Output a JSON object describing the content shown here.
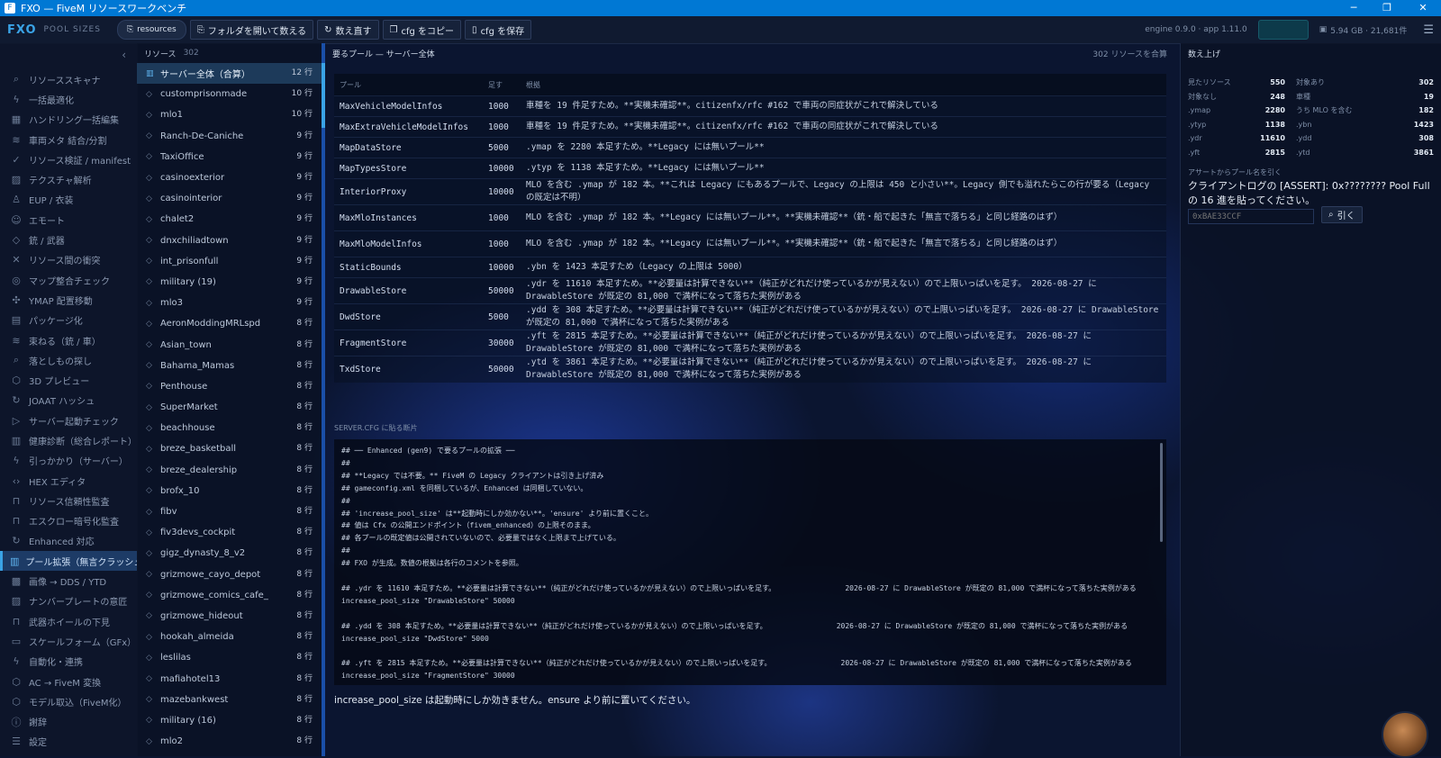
{
  "window": {
    "title": "FXO — FiveM リソースワークベンチ",
    "controls": {
      "minimize": "─",
      "restore": "❐",
      "close": "✕"
    }
  },
  "toolbar": {
    "logo": "FXO",
    "section": "POOL SIZES",
    "folder_pill": "resources",
    "buttons": {
      "open_count": "フォルダを開いて数える",
      "recount": "数え直す",
      "copy_cfg": "cfg をコピー",
      "save_cfg": "cfg を保存"
    },
    "version": "engine 0.9.0 · app 1.11.0",
    "system_info": "5.94 GB · 21,681件"
  },
  "sidebar": {
    "collapse": "‹",
    "items": [
      {
        "label": "リソーススキャナ",
        "icon": "search-icon",
        "glyph": "⌕"
      },
      {
        "label": "一括最適化",
        "icon": "bolt-icon",
        "glyph": "ϟ"
      },
      {
        "label": "ハンドリング一括編集",
        "icon": "grid-icon",
        "glyph": "▦"
      },
      {
        "label": "車両メタ 結合/分割",
        "icon": "layers-icon",
        "glyph": "≋"
      },
      {
        "label": "リソース検証 / manifest",
        "icon": "check-circle-icon",
        "glyph": "✓"
      },
      {
        "label": "テクスチャ解析",
        "icon": "image-icon",
        "glyph": "▨"
      },
      {
        "label": "EUP / 衣装",
        "icon": "person-icon",
        "glyph": "♙"
      },
      {
        "label": "エモート",
        "icon": "smile-icon",
        "glyph": "☺"
      },
      {
        "label": "銃 / 武器",
        "icon": "diamond-icon",
        "glyph": "◇"
      },
      {
        "label": "リソース間の衝突",
        "icon": "cross-icon",
        "glyph": "✕"
      },
      {
        "label": "マップ整合チェック",
        "icon": "map-pin-icon",
        "glyph": "◎"
      },
      {
        "label": "YMAP 配置移動",
        "icon": "move-icon",
        "glyph": "✣"
      },
      {
        "label": "パッケージ化",
        "icon": "package-icon",
        "glyph": "▤"
      },
      {
        "label": "束ねる（銃 / 車）",
        "icon": "stack-icon",
        "glyph": "≋"
      },
      {
        "label": "落としもの探し",
        "icon": "search-icon",
        "glyph": "⌕"
      },
      {
        "label": "3D プレビュー",
        "icon": "cube-icon",
        "glyph": "⬡"
      },
      {
        "label": "JOAAT ハッシュ",
        "icon": "refresh-icon",
        "glyph": "↻"
      },
      {
        "label": "サーバー起動チェック",
        "icon": "play-icon",
        "glyph": "▷"
      },
      {
        "label": "健康診断（総合レポート）",
        "icon": "chart-icon",
        "glyph": "▥"
      },
      {
        "label": "引っかかり（サーバー）",
        "icon": "bolt-icon",
        "glyph": "ϟ"
      },
      {
        "label": "HEX エディタ",
        "icon": "code-icon",
        "glyph": "‹›"
      },
      {
        "label": "リソース信頼性監査",
        "icon": "lock-icon",
        "glyph": "⊓"
      },
      {
        "label": "エスクロー暗号化監査",
        "icon": "lock-icon",
        "glyph": "⊓"
      },
      {
        "label": "Enhanced 対応",
        "icon": "sync-icon",
        "glyph": "↻"
      },
      {
        "label": "プール拡張（無言クラッシュ）",
        "icon": "bar-chart-icon",
        "glyph": "▥",
        "active": true
      },
      {
        "label": "画像 → DDS / YTD",
        "icon": "checker-icon",
        "glyph": "▩"
      },
      {
        "label": "ナンバープレートの意匠",
        "icon": "image-icon",
        "glyph": "▨"
      },
      {
        "label": "武器ホイールの下見",
        "icon": "lock-icon",
        "glyph": "⊓"
      },
      {
        "label": "スケールフォーム（GFx）",
        "icon": "monitor-icon",
        "glyph": "▭"
      },
      {
        "label": "自動化・連携",
        "icon": "bolt-icon",
        "glyph": "ϟ"
      },
      {
        "label": "AC → FiveM 変換",
        "icon": "cube-icon",
        "glyph": "⬡"
      },
      {
        "label": "モデル取込（FiveM化）",
        "icon": "cube-icon",
        "glyph": "⬡"
      },
      {
        "label": "謝辞",
        "icon": "info-icon",
        "glyph": "ⓘ"
      },
      {
        "label": "設定",
        "icon": "sliders-icon",
        "glyph": "☰"
      }
    ]
  },
  "resources": {
    "title": "リソース",
    "count": "302",
    "items": [
      {
        "name": "サーバー全体（合算）",
        "lines": "12 行",
        "active": true
      },
      {
        "name": "customprisonmade",
        "lines": "10 行"
      },
      {
        "name": "mlo1",
        "lines": "10 行"
      },
      {
        "name": "Ranch-De-Caniche",
        "lines": "9 行"
      },
      {
        "name": "TaxiOffice",
        "lines": "9 行"
      },
      {
        "name": "casinoexterior",
        "lines": "9 行"
      },
      {
        "name": "casinointerior",
        "lines": "9 行"
      },
      {
        "name": "chalet2",
        "lines": "9 行"
      },
      {
        "name": "dnxchiliadtown",
        "lines": "9 行"
      },
      {
        "name": "int_prisonfull",
        "lines": "9 行"
      },
      {
        "name": "military (19)",
        "lines": "9 行"
      },
      {
        "name": "mlo3",
        "lines": "9 行"
      },
      {
        "name": "AeronModdingMRLspd",
        "lines": "8 行"
      },
      {
        "name": "Asian_town",
        "lines": "8 行"
      },
      {
        "name": "Bahama_Mamas",
        "lines": "8 行"
      },
      {
        "name": "Penthouse",
        "lines": "8 行"
      },
      {
        "name": "SuperMarket",
        "lines": "8 行"
      },
      {
        "name": "beachhouse",
        "lines": "8 行"
      },
      {
        "name": "breze_basketball",
        "lines": "8 行"
      },
      {
        "name": "breze_dealership",
        "lines": "8 行"
      },
      {
        "name": "brofx_10",
        "lines": "8 行"
      },
      {
        "name": "fibv",
        "lines": "8 行"
      },
      {
        "name": "fiv3devs_cockpit",
        "lines": "8 行"
      },
      {
        "name": "gigz_dynasty_8_v2",
        "lines": "8 行"
      },
      {
        "name": "grizmowe_cayo_depot",
        "lines": "8 行"
      },
      {
        "name": "grizmowe_comics_cafe_",
        "lines": "8 行"
      },
      {
        "name": "grizmowe_hideout",
        "lines": "8 行"
      },
      {
        "name": "hookah_almeida",
        "lines": "8 行"
      },
      {
        "name": "leslilas",
        "lines": "8 行"
      },
      {
        "name": "mafiahotel13",
        "lines": "8 行"
      },
      {
        "name": "mazebankwest",
        "lines": "8 行"
      },
      {
        "name": "military (16)",
        "lines": "8 行"
      },
      {
        "name": "mlo2",
        "lines": "8 行"
      }
    ]
  },
  "main": {
    "title": "要るプール — サーバー全体",
    "summary": "302 リソースを合算",
    "columns": {
      "pool": "プール",
      "size": "足す",
      "reason": "根拠"
    },
    "pools": [
      {
        "name": "MaxVehicleModelInfos",
        "size": "1000",
        "reason": "車種を 19 件足すため。**実機未確認**。citizenfx/rfc #162 で車両の同症状がこれで解決している"
      },
      {
        "name": "MaxExtraVehicleModelInfos",
        "size": "1000",
        "reason": "車種を 19 件足すため。**実機未確認**。citizenfx/rfc #162 で車両の同症状がこれで解決している"
      },
      {
        "name": "MapDataStore",
        "size": "5000",
        "reason": ".ymap を 2280 本足すため。**Legacy には無いプール**"
      },
      {
        "name": "MapTypesStore",
        "size": "10000",
        "reason": ".ytyp を 1138 本足すため。**Legacy には無いプール**"
      },
      {
        "name": "InteriorProxy",
        "size": "10000",
        "reason": "MLO を含む .ymap が 182 本。**これは Legacy にもあるプールで、Legacy の上限は 450 と小さい**。Legacy 側でも溢れたらこの行が要る（Legacy の既定は不明）"
      },
      {
        "name": "MaxMloInstances",
        "size": "1000",
        "reason": "MLO を含む .ymap が 182 本。**Legacy には無いプール**。**実機未確認**（銃・船で起きた「無言で落ちる」と同じ経路のはず）"
      },
      {
        "name": "MaxMloModelInfos",
        "size": "1000",
        "reason": "MLO を含む .ymap が 182 本。**Legacy には無いプール**。**実機未確認**（銃・船で起きた「無言で落ちる」と同じ経路のはず）"
      },
      {
        "name": "StaticBounds",
        "size": "10000",
        "reason": ".ybn を 1423 本足すため（Legacy の上限は 5000）"
      },
      {
        "name": "DrawableStore",
        "size": "50000",
        "reason": ".ydr を 11610 本足すため。**必要量は計算できない**（純正がどれだけ使っているかが見えない）ので上限いっぱいを足す。 2026-08-27 に DrawableStore が既定の 81,000 で満杯になって落ちた実例がある"
      },
      {
        "name": "DwdStore",
        "size": "5000",
        "reason": ".ydd を 308 本足すため。**必要量は計算できない**（純正がどれだけ使っているかが見えない）ので上限いっぱいを足す。 2026-08-27 に DrawableStore が既定の 81,000 で満杯になって落ちた実例がある"
      },
      {
        "name": "FragmentStore",
        "size": "30000",
        "reason": ".yft を 2815 本足すため。**必要量は計算できない**（純正がどれだけ使っているかが見えない）ので上限いっぱいを足す。 2026-08-27 に DrawableStore が既定の 81,000 で満杯になって落ちた実例がある"
      },
      {
        "name": "TxdStore",
        "size": "50000",
        "reason": ".ytd を 3861 本足すため。**必要量は計算できない**（純正がどれだけ使っているかが見えない）ので上限いっぱいを足す。 2026-08-27 に DrawableStore が既定の 81,000 で満杯になって落ちた実例がある"
      }
    ],
    "snippet_label": "SERVER.CFG に貼る断片",
    "snippet": "## ── Enhanced (gen9) で要るプールの拡張 ──\n##\n## **Legacy では不要。** FiveM の Legacy クライアントは引き上げ済み\n## gameconfig.xml を同梱しているが、Enhanced は同梱していない。\n##\n## 'increase_pool_size' は**起動時にしか効かない**。'ensure' より前に置くこと。\n## 値は Cfx の公開エンドポイント（fivem_enhanced）の上限そのまま。\n## 各プールの既定値は公開されていないので、必要量ではなく上限まで上げている。\n##\n## FXO が生成。数値の根拠は各行のコメントを参照。\n\n## .ydr を 11610 本足すため。**必要量は計算できない**（純正がどれだけ使っているかが見えない）ので上限いっぱいを足す。                2026-08-27 に DrawableStore が既定の 81,000 で満杯になって落ちた実例がある\nincrease_pool_size \"DrawableStore\" 50000\n\n## .ydd を 308 本足すため。**必要量は計算できない**（純正がどれだけ使っているかが見えない）ので上限いっぱいを足す。                2026-08-27 に DrawableStore が既定の 81,000 で満杯になって落ちた実例がある\nincrease_pool_size \"DwdStore\" 5000\n\n## .yft を 2815 本足すため。**必要量は計算できない**（純正がどれだけ使っているかが見えない）ので上限いっぱいを足す。                2026-08-27 に DrawableStore が既定の 81,000 で満杯になって落ちた実例がある\nincrease_pool_size \"FragmentStore\" 30000",
    "note": "increase_pool_size は起動時にしか効きません。ensure より前に置いてください。"
  },
  "counts": {
    "title": "数え上げ",
    "rows": [
      {
        "l1": "見たリソース",
        "v1": "550",
        "l2": "対象あり",
        "v2": "302"
      },
      {
        "l1": "対象なし",
        "v1": "248",
        "l2": "車種",
        "v2": "19"
      },
      {
        "l1": ".ymap",
        "v1": "2280",
        "l2": "うち MLO を含む",
        "v2": "182"
      },
      {
        "l1": ".ytyp",
        "v1": "1138",
        "l2": ".ybn",
        "v2": "1423"
      },
      {
        "l1": ".ydr",
        "v1": "11610",
        "l2": ".ydd",
        "v2": "308"
      },
      {
        "l1": ".yft",
        "v1": "2815",
        "l2": ".ytd",
        "v2": "3861"
      }
    ],
    "lookup_label": "アサートからプール名を引く",
    "lookup_title": "クライアントログの [ASSERT]: 0x???????? Pool Full の 16 進を貼ってください。",
    "lookup_placeholder": "0xBAE33CCF",
    "lookup_button": "引く"
  }
}
